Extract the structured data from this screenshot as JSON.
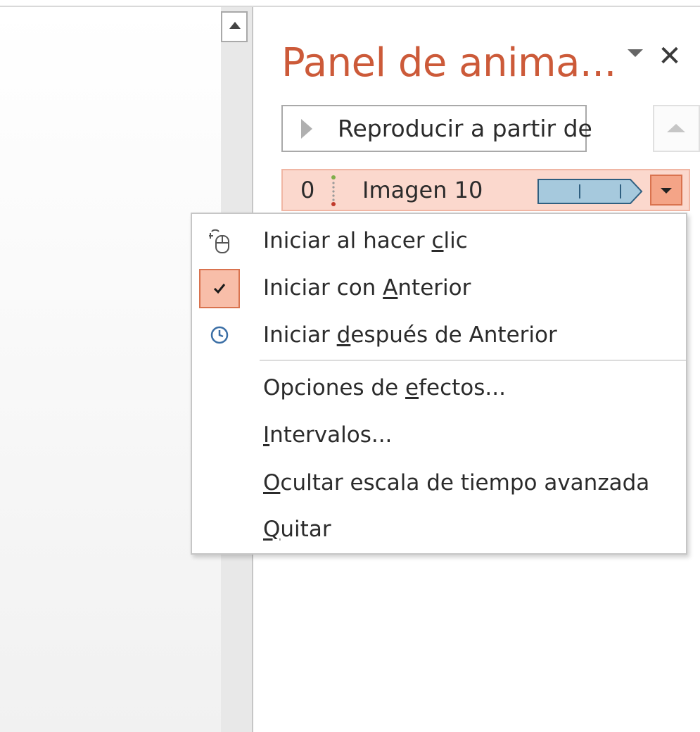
{
  "animation_pane": {
    "title": "Panel de anima...",
    "menu_icon": "chevron-down-icon",
    "close_icon": "close-icon",
    "close_glyph": "✕",
    "play_button": {
      "label": "Reproducir a partir de",
      "icon": "play-icon"
    },
    "reorder_up_icon": "arrow-up-icon"
  },
  "animation_list": [
    {
      "number": "0",
      "effect_icon": "effect-indicator-icon",
      "name": "Imagen 10",
      "selected": true
    }
  ],
  "context_menu": {
    "items": [
      {
        "label_before": "Iniciar al hacer ",
        "mnemonic": "c",
        "label_after": "lic",
        "icon": "mouse-click-icon",
        "checked": false
      },
      {
        "label_before": "Iniciar con ",
        "mnemonic": "A",
        "label_after": "nterior",
        "icon": "checkmark-icon",
        "checked": true
      },
      {
        "label_before": "Iniciar ",
        "mnemonic": "d",
        "label_after": "espués de Anterior",
        "icon": "clock-icon",
        "checked": false
      },
      {
        "label_before": "Opciones de ",
        "mnemonic": "e",
        "label_after": "fectos...",
        "icon": "",
        "checked": false
      },
      {
        "label_before": "",
        "mnemonic": "I",
        "label_after": "ntervalos...",
        "icon": "",
        "checked": false
      },
      {
        "label_before": "",
        "mnemonic": "O",
        "label_after": "cultar escala de tiempo avanzada",
        "icon": "",
        "checked": false
      },
      {
        "label_before": "",
        "mnemonic": "Q",
        "label_after": "uitar",
        "icon": "",
        "checked": false
      }
    ]
  },
  "colors": {
    "title_accent": "#cc5a39",
    "selected_item_bg": "#fbd8cd",
    "checked_bg": "#f8bea9",
    "checked_border": "#d9734f",
    "timing_bar_fill": "#a6c9dd",
    "timing_bar_border": "#2f5f80"
  }
}
